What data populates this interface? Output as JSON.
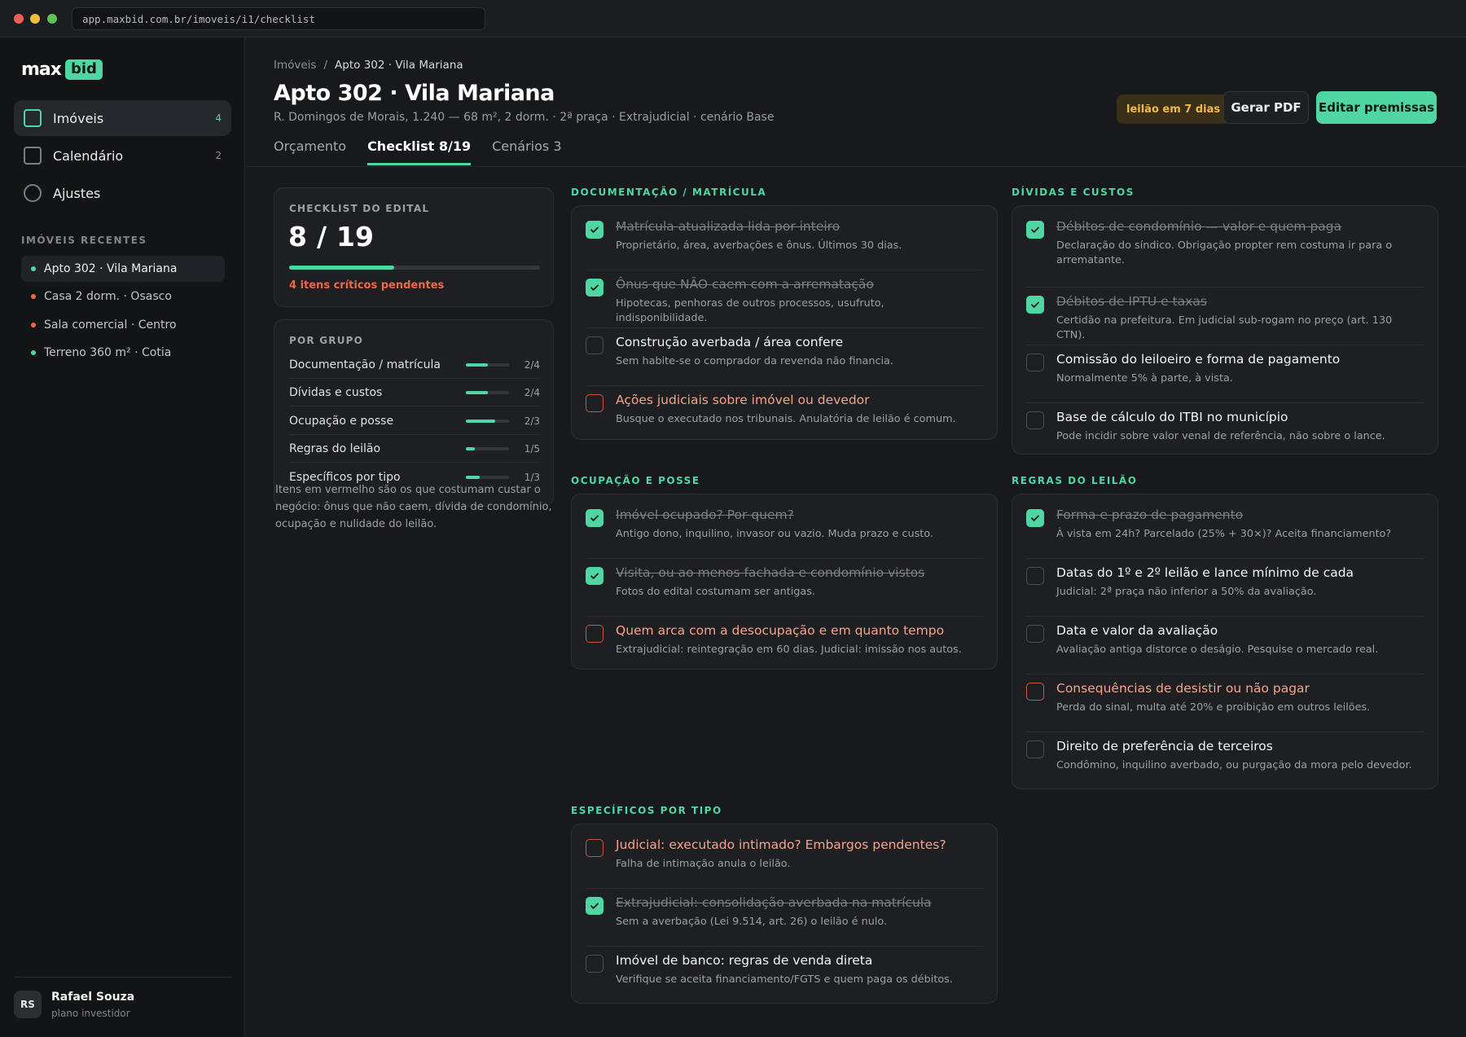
{
  "browser": {
    "url": "app.maxbid.com.br/imoveis/i1/checklist"
  },
  "colors": {
    "accent": "#4fd6a3",
    "critical": "#f2664a",
    "warning": "#f2b84b",
    "background": "#17191c"
  },
  "sidebar": {
    "logo_max": "max",
    "logo_bid": "bid",
    "nav": [
      {
        "label": "Imóveis",
        "count": "4",
        "icon": "square-icon"
      },
      {
        "label": "Calendário",
        "count": "2",
        "icon": "square-icon"
      },
      {
        "label": "Ajustes",
        "count": "",
        "icon": "circle-icon"
      }
    ],
    "recent_title": "IMÓVEIS RECENTES",
    "recent": [
      {
        "label": "Apto 302 · Vila Mariana",
        "status_color": "#4fd6a3"
      },
      {
        "label": "Casa 2 dorm. · Osasco",
        "status_color": "#f2664a"
      },
      {
        "label": "Sala comercial · Centro",
        "status_color": "#f2664a"
      },
      {
        "label": "Terreno 360 m² · Cotia",
        "status_color": "#4fd6a3"
      }
    ],
    "user": {
      "initials": "RS",
      "name": "Rafael Souza",
      "plan": "plano investidor"
    }
  },
  "header": {
    "breadcrumb": [
      "Imóveis",
      "/",
      "Apto 302 · Vila Mariana"
    ],
    "title": "Apto 302 · Vila Mariana",
    "subtitle": "R. Domingos de Morais, 1.240 — 68 m², 2 dorm. · 2ª praça · Extrajudicial · cenário Base",
    "tabs": [
      "Orçamento",
      "Checklist 8/19",
      "Cenários 3"
    ],
    "badge": "leilão em 7 dias",
    "btn_pdf": "Gerar PDF",
    "btn_edit": "Editar premissas"
  },
  "summary": {
    "label": "CHECKLIST DO EDITAL",
    "done": "8",
    "slash": "/",
    "total": "19",
    "progress": 0.42,
    "critical": "4 itens críticos pendentes"
  },
  "groups": {
    "title": "POR GRUPO",
    "rows": [
      {
        "name": "Documentação / matrícula",
        "value": "2/4",
        "progress": 0.5
      },
      {
        "name": "Dívidas e custos",
        "value": "2/4",
        "progress": 0.5
      },
      {
        "name": "Ocupação e posse",
        "value": "2/3",
        "progress": 0.67
      },
      {
        "name": "Regras do leilão",
        "value": "1/5",
        "progress": 0.2
      },
      {
        "name": "Específicos por tipo",
        "value": "1/3",
        "progress": 0.33
      }
    ]
  },
  "note": "Itens em vermelho são os que costumam custar o negócio: ônus que não caem, dívida de condomínio, ocupação e nulidade do leilão.",
  "sections": {
    "doc": {
      "title": "DOCUMENTAÇÃO / MATRÍCULA",
      "items": [
        {
          "title": "Matrícula atualizada lida por inteiro",
          "desc": "Proprietário, área, averbações e ônus. Últimos 30 dias.",
          "state": "done"
        },
        {
          "title": "Ônus que NÃO caem com a arrematação",
          "desc": "Hipotecas, penhoras de outros processos, usufruto, indisponibilidade.",
          "state": "done"
        },
        {
          "title": "Construção averbada / área confere",
          "desc": "Sem habite-se o comprador da revenda não financia.",
          "state": "open"
        },
        {
          "title": "Ações judiciais sobre imóvel ou devedor",
          "desc": "Busque o executado nos tribunais. Anulatória de leilão é comum.",
          "state": "critical"
        }
      ]
    },
    "debts": {
      "title": "DÍVIDAS E CUSTOS",
      "items": [
        {
          "title": "Débitos de condomínio — valor e quem paga",
          "desc": "Declaração do síndico. Obrigação propter rem costuma ir para o arrematante.",
          "state": "done"
        },
        {
          "title": "Débitos de IPTU e taxas",
          "desc": "Certidão na prefeitura. Em judicial sub-rogam no preço (art. 130 CTN).",
          "state": "done"
        },
        {
          "title": "Comissão do leiloeiro e forma de pagamento",
          "desc": "Normalmente 5% à parte, à vista.",
          "state": "open"
        },
        {
          "title": "Base de cálculo do ITBI no município",
          "desc": "Pode incidir sobre valor venal de referência, não sobre o lance.",
          "state": "open"
        }
      ]
    },
    "occ": {
      "title": "OCUPAÇÃO E POSSE",
      "items": [
        {
          "title": "Imóvel ocupado? Por quem?",
          "desc": "Antigo dono, inquilino, invasor ou vazio. Muda prazo e custo.",
          "state": "done"
        },
        {
          "title": "Visita, ou ao menos fachada e condomínio vistos",
          "desc": "Fotos do edital costumam ser antigas.",
          "state": "done"
        },
        {
          "title": "Quem arca com a desocupação e em quanto tempo",
          "desc": "Extrajudicial: reintegração em 60 dias. Judicial: imissão nos autos.",
          "state": "critical"
        }
      ]
    },
    "rules": {
      "title": "REGRAS DO LEILÃO",
      "items": [
        {
          "title": "Forma e prazo de pagamento",
          "desc": "À vista em 24h? Parcelado (25% + 30×)? Aceita financiamento?",
          "state": "done"
        },
        {
          "title": "Datas do 1º e 2º leilão e lance mínimo de cada",
          "desc": "Judicial: 2ª praça não inferior a 50% da avaliação.",
          "state": "open"
        },
        {
          "title": "Data e valor da avaliação",
          "desc": "Avaliação antiga distorce o deságio. Pesquise o mercado real.",
          "state": "open"
        },
        {
          "title": "Consequências de desistir ou não pagar",
          "desc": "Perda do sinal, multa até 20% e proibição em outros leilões.",
          "state": "critical"
        },
        {
          "title": "Direito de preferência de terceiros",
          "desc": "Condômino, inquilino averbado, ou purgação da mora pelo devedor.",
          "state": "open"
        }
      ]
    },
    "spec": {
      "title": "ESPECÍFICOS POR TIPO",
      "items": [
        {
          "title": "Judicial: executado intimado? Embargos pendentes?",
          "desc": "Falha de intimação anula o leilão.",
          "state": "critical"
        },
        {
          "title": "Extrajudicial: consolidação averbada na matrícula",
          "desc": "Sem a averbação (Lei 9.514, art. 26) o leilão é nulo.",
          "state": "done"
        },
        {
          "title": "Imóvel de banco: regras de venda direta",
          "desc": "Verifique se aceita financiamento/FGTS e quem paga os débitos.",
          "state": "open"
        }
      ]
    }
  }
}
